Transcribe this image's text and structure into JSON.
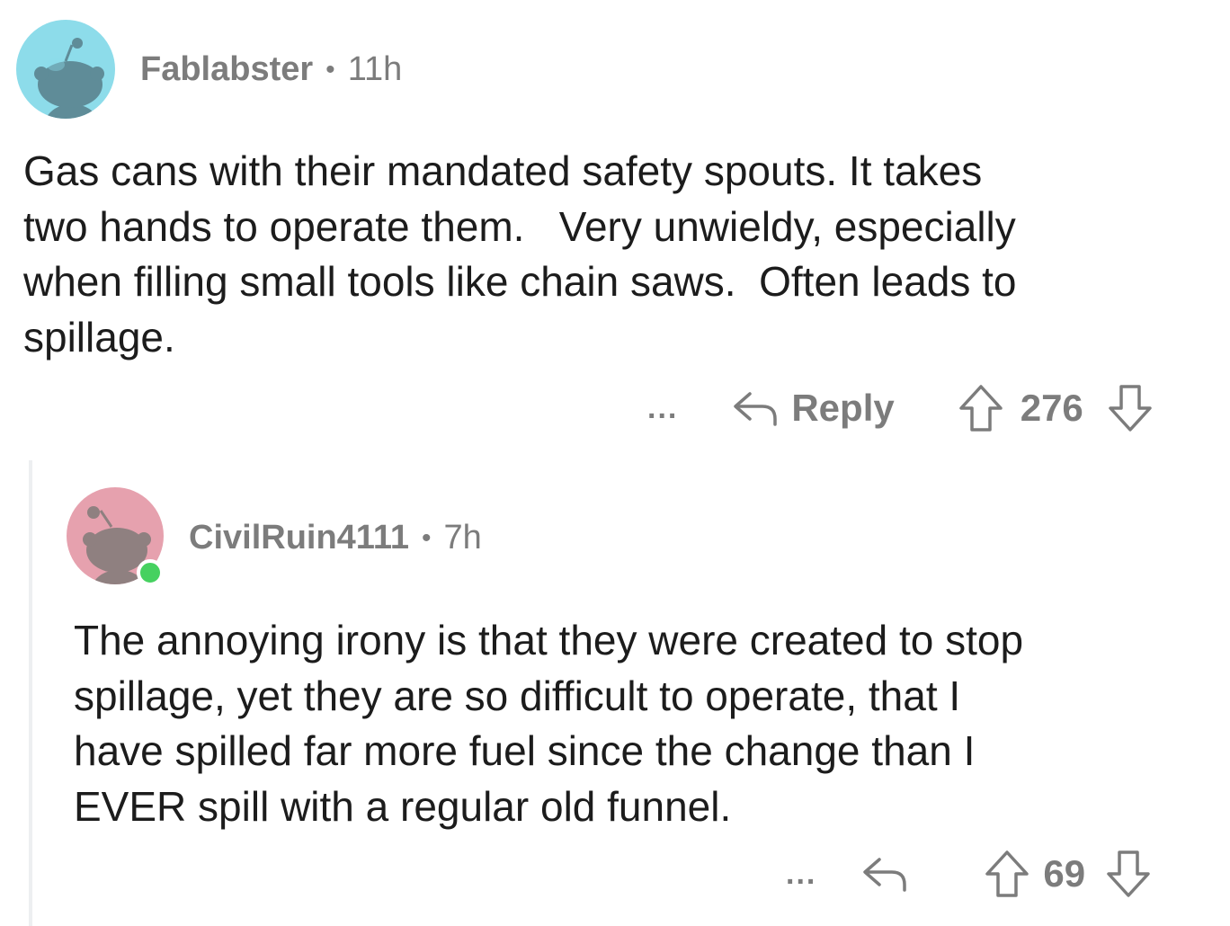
{
  "comments": [
    {
      "username": "Fablabster",
      "separator": "•",
      "time": "11h",
      "lines": [
        "Gas cans with their mandated safety spouts. It takes",
        "two hands to operate them.   Very unwieldy, especially",
        "when filling small tools like chain saws.  Often leads to",
        "spillage."
      ],
      "more_label": "...",
      "reply_label": "Reply",
      "votes": "276",
      "avatar_color": "#8ddcea",
      "icons": [
        "avatar-snoo-icon",
        "reply-arrow-icon",
        "upvote-arrow-icon",
        "downvote-arrow-icon"
      ]
    },
    {
      "username": "CivilRuin4111",
      "separator": "•",
      "time": "7h",
      "lines": [
        "The annoying irony is that they were created to stop",
        "spillage, yet they are so difficult to operate, that I",
        "have spilled far more fuel since the change than I",
        "EVER spill with a regular old funnel."
      ],
      "more_label": "...",
      "reply_label": "",
      "votes": "69",
      "avatar_color": "#e6a1ae",
      "online": true,
      "online_color": "#46d160",
      "icons": [
        "avatar-snoo-icon",
        "reply-arrow-icon",
        "upvote-arrow-icon",
        "downvote-arrow-icon"
      ]
    }
  ],
  "colors": {
    "meta_text": "#7c7c7c",
    "body_text": "#1c1c1c",
    "thread_line": "#edeff1"
  }
}
